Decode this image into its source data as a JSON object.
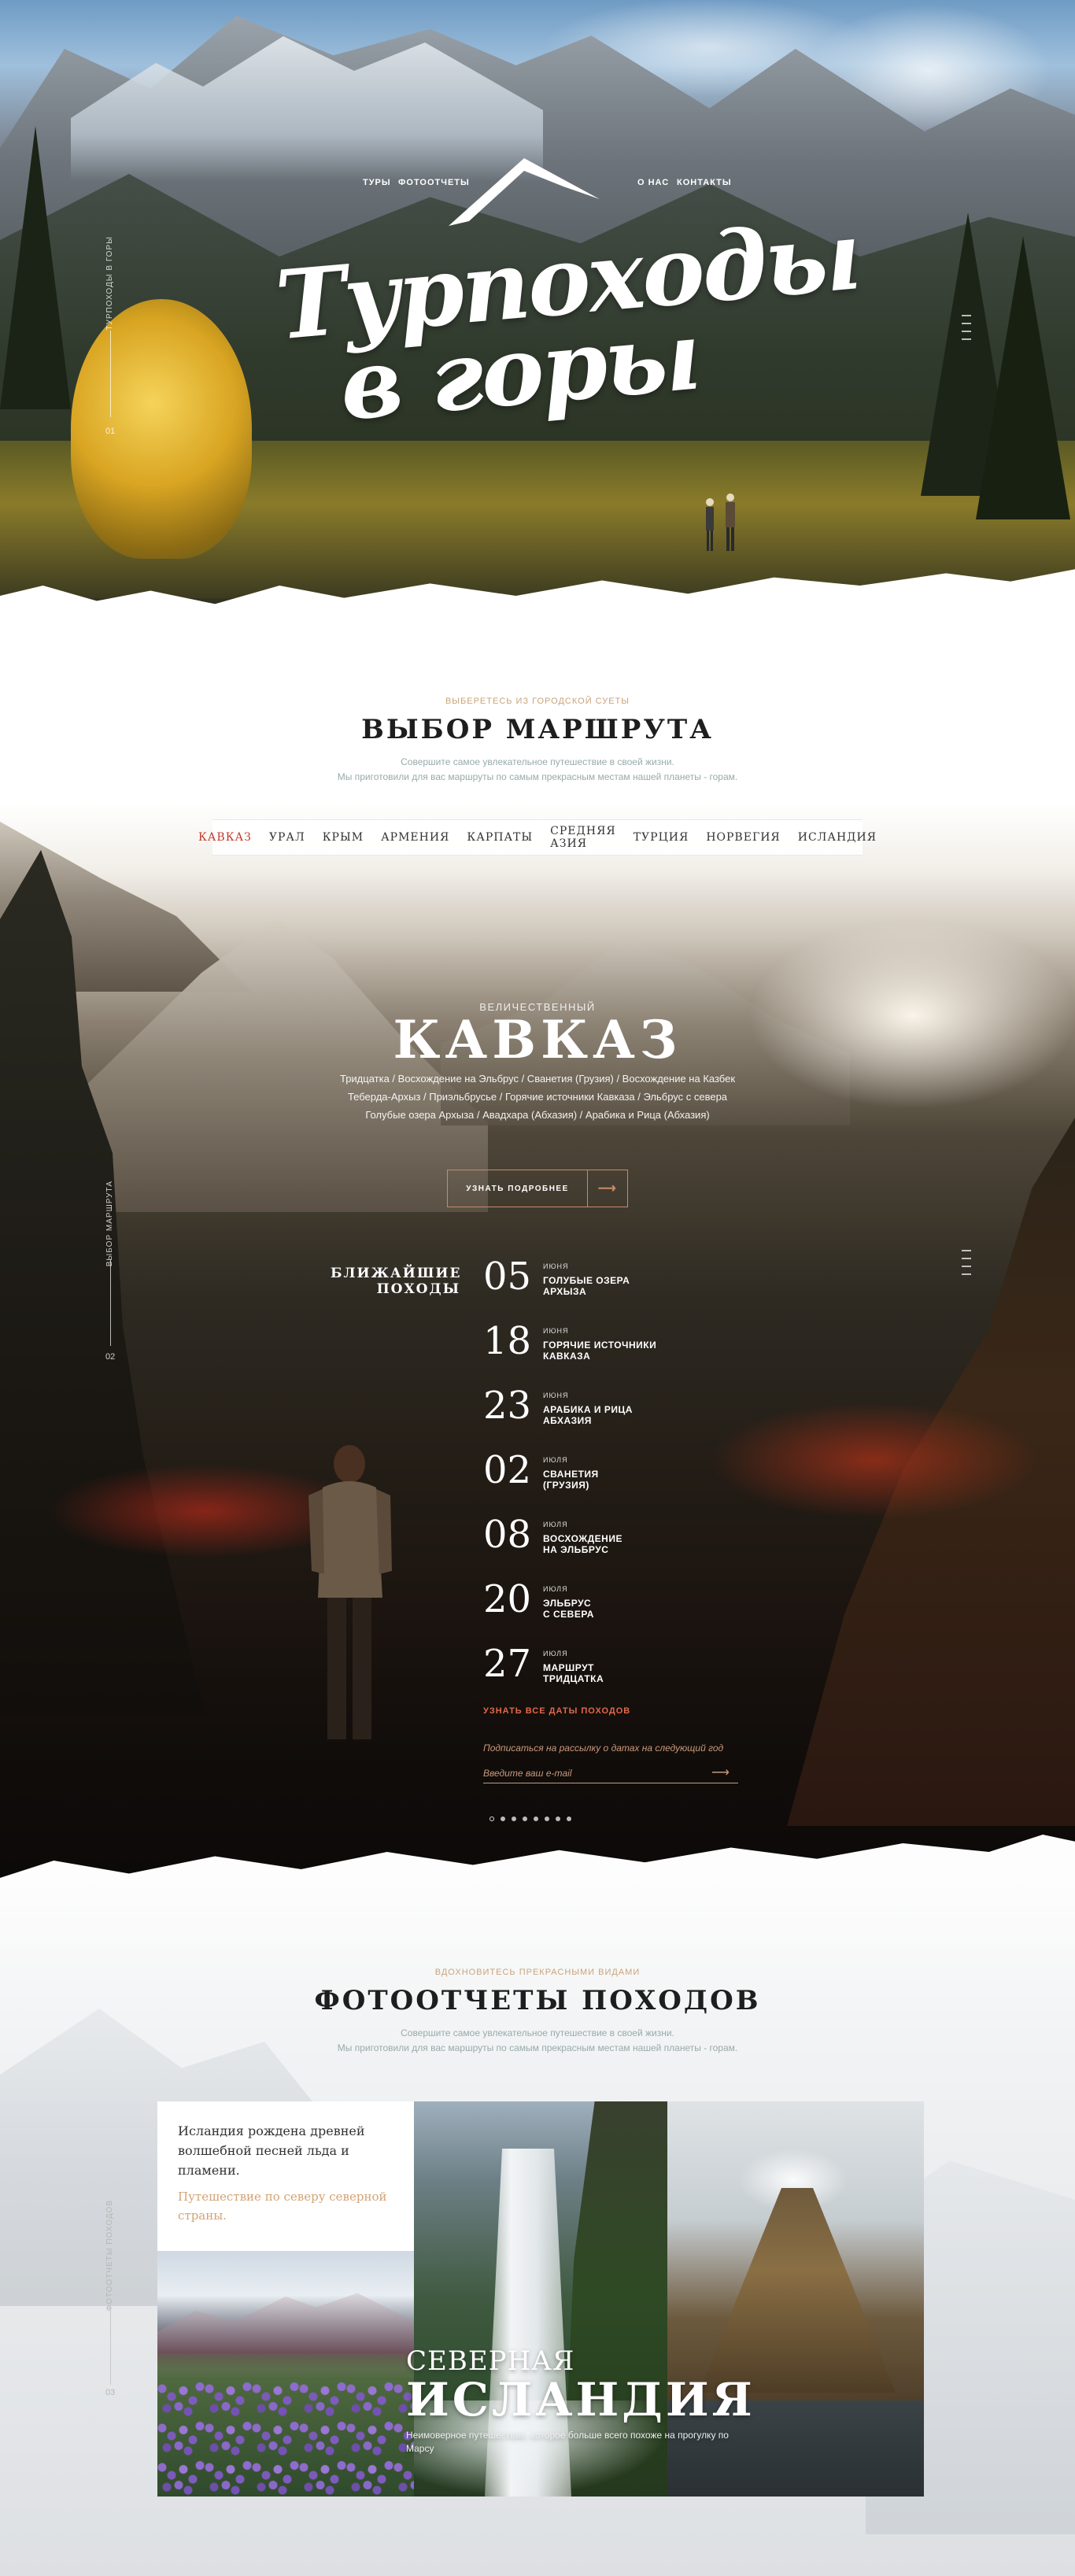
{
  "header": {
    "nav": [
      "ТУРЫ",
      "ФОТООТЧЕТЫ",
      "О НАС",
      "КОНТАКТЫ"
    ],
    "title_line1": "Турпоходы",
    "title_line2": "в горы",
    "side_label": "ТУРПОХОДЫ В ГОРЫ",
    "side_num": "01"
  },
  "route": {
    "kicker": "ВЫБЕРЕТЕСЬ ИЗ ГОРОДСКОЙ СУЕТЫ",
    "title": "ВЫБОР МАРШРУТА",
    "desc_line1": "Совершите самое увлекательное путешествие в своей жизни.",
    "desc_line2": "Мы приготовили для вас маршруты по самым прекрасным местам нашей планеты - горам.",
    "tabs": [
      "КАВКАЗ",
      "УРАЛ",
      "КРЫМ",
      "АРМЕНИЯ",
      "КАРПАТЫ",
      "СРЕДНЯЯ АЗИЯ",
      "ТУРЦИЯ",
      "НОРВЕГИЯ",
      "ИСЛАНДИЯ"
    ]
  },
  "caucasus": {
    "kicker": "ВЕЛИЧЕСТВЕННЫЙ",
    "title": "КАВКАЗ",
    "routes_line1": "Тридцатка / Восхождение на Эльбрус / Сванетия (Грузия) / Восхождение на Казбек",
    "routes_line2": "Теберда-Архыз / Приэльбрусье / Горячие источники Кавказа / Эльбрус с севера",
    "routes_line3": "Голубые озера Архыза / Авадхара (Абхазия) / Арабика и Рица (Абхазия)",
    "more_button": "УЗНАТЬ ПОДРОБНЕЕ",
    "side_label": "ВЫБОР МАРШРУТА",
    "side_num": "02",
    "upcoming_title": "БЛИЖАЙШИЕ ПОХОДЫ",
    "hikes": [
      {
        "day": "05",
        "month": "ИЮНЯ",
        "name1": "ГОЛУБЫЕ ОЗЕРА",
        "name2": "АРХЫЗА"
      },
      {
        "day": "18",
        "month": "ИЮНЯ",
        "name1": "ГОРЯЧИЕ ИСТОЧНИКИ",
        "name2": "КАВКАЗА"
      },
      {
        "day": "23",
        "month": "ИЮНЯ",
        "name1": "АРАБИКА И РИЦА",
        "name2": "АБХАЗИЯ"
      },
      {
        "day": "02",
        "month": "ИЮЛЯ",
        "name1": "СВАНЕТИЯ",
        "name2": "(ГРУЗИЯ)"
      },
      {
        "day": "08",
        "month": "ИЮЛЯ",
        "name1": "ВОСХОЖДЕНИЕ",
        "name2": "НА ЭЛЬБРУС"
      },
      {
        "day": "20",
        "month": "ИЮЛЯ",
        "name1": "ЭЛЬБРУС",
        "name2": "С СЕВЕРА"
      },
      {
        "day": "27",
        "month": "ИЮЛЯ",
        "name1": "МАРШРУТ",
        "name2": "ТРИДЦАТКА"
      }
    ],
    "all_dates": "УЗНАТЬ ВСЕ ДАТЫ ПОХОДОВ",
    "subscribe_hint": "Подписаться на рассылку о датах на следующий год",
    "email_placeholder": "Введите ваш e-mail"
  },
  "photos": {
    "kicker": "ВДОХНОВИТЕСЬ ПРЕКРАСНЫМИ ВИДАМИ",
    "title": "ФОТООТЧЕТЫ ПОХОДОВ",
    "desc_line1": "Совершите самое увлекательное путешествие в своей жизни.",
    "desc_line2": "Мы приготовили для вас маршруты по самым прекрасным местам нашей планеты - горам.",
    "card_text": "Исландия рождена древней волшебной песней льда и пламени.",
    "card_link": "Путешествие по северу северной страны.",
    "caption_small": "СЕВЕРНАЯ",
    "caption_big": "ИСЛАНДИЯ",
    "caption_desc": "Неимоверное путешествие, которое больше всего похоже на прогулку по Марсу",
    "side_label": "ФОТООТЧЕТЫ ПОХОДОВ",
    "side_num": "03"
  }
}
